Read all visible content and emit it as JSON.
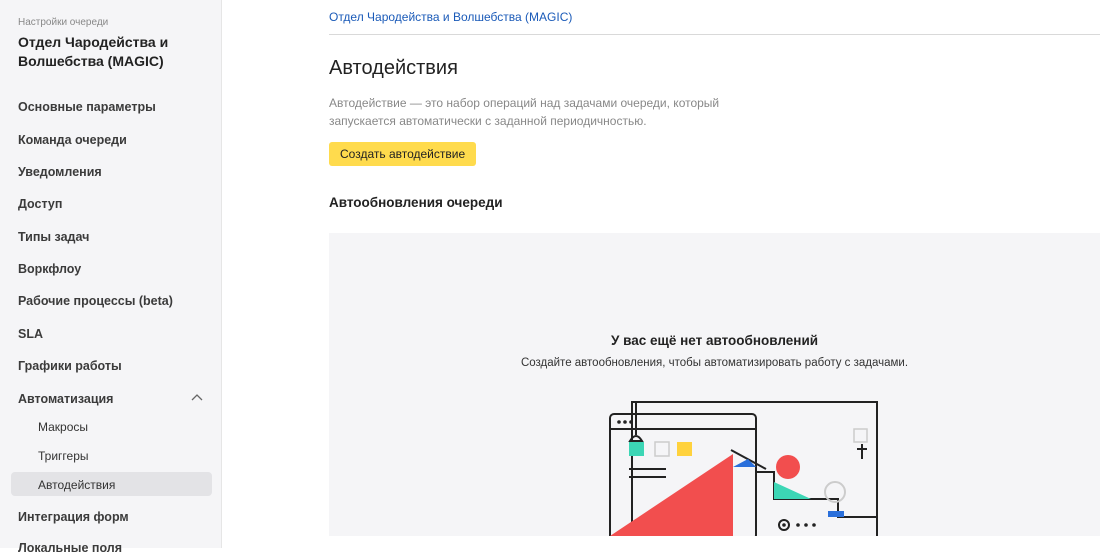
{
  "sidebar": {
    "caption": "Настройки очереди",
    "title": "Отдел Чародейства и Волшебства (MAGIC)",
    "items": [
      {
        "label": "Основные параметры"
      },
      {
        "label": "Команда очереди"
      },
      {
        "label": "Уведомления"
      },
      {
        "label": "Доступ"
      },
      {
        "label": "Типы задач"
      },
      {
        "label": "Воркфлоу"
      },
      {
        "label": "Рабочие процессы (beta)"
      },
      {
        "label": "SLA"
      },
      {
        "label": "Графики работы"
      },
      {
        "label": "Автоматизация"
      },
      {
        "label": "Интеграция форм"
      },
      {
        "label": "Локальные поля"
      }
    ],
    "automation_subitems": [
      {
        "label": "Макросы"
      },
      {
        "label": "Триггеры"
      },
      {
        "label": "Автодействия",
        "active": true
      }
    ],
    "expand_icon": "chevron-up-icon"
  },
  "main": {
    "breadcrumb": "Отдел Чародейства и Волшебства (MAGIC)",
    "title": "Автодействия",
    "description": "Автодействие — это набор операций над задачами очереди, который запускается автоматически с заданной периодичностью.",
    "create_button": "Создать автодействие",
    "section_title": "Автообновления очереди",
    "empty_state": {
      "title": "У вас ещё нет автообновлений",
      "text": "Создайте автообновления, чтобы автоматизировать работу с задачами."
    }
  },
  "colors": {
    "accent_button": "#ffdb4d",
    "link": "#1a5ab8",
    "illustration_red": "#f24e4e",
    "illustration_teal": "#3cd6b5",
    "illustration_yellow": "#ffd23d",
    "illustration_blue": "#2a6fdb"
  }
}
